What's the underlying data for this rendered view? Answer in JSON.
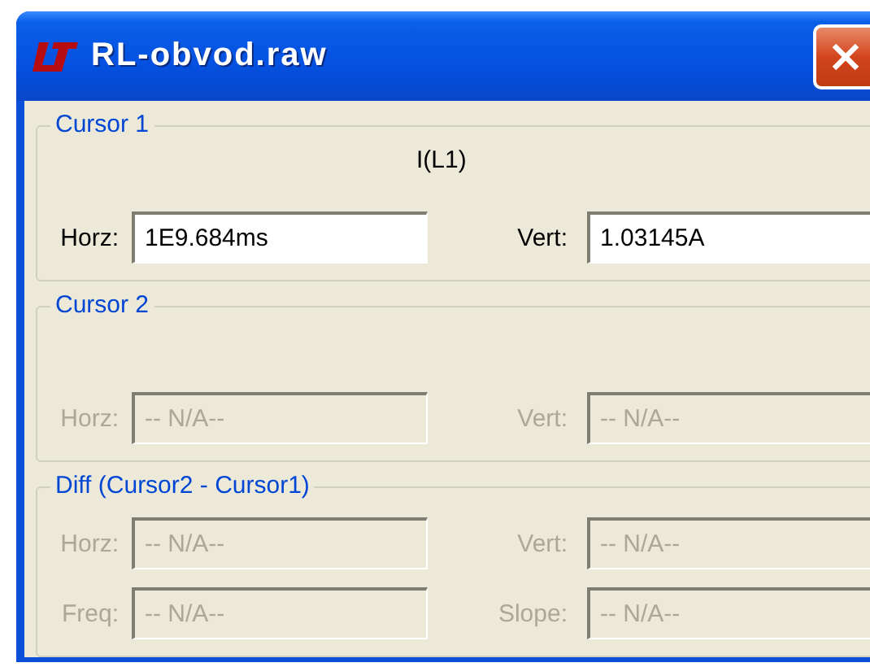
{
  "window": {
    "title": "RL-obvod.raw"
  },
  "groups": [
    {
      "kind": "cursor",
      "title": "Cursor 1",
      "trace": "I(L1)",
      "rows": [
        [
          {
            "label": "Horz:",
            "value": "1E9.684ms",
            "disabled": false
          },
          {
            "label": "Vert:",
            "value": "1.03145A",
            "disabled": false
          }
        ]
      ]
    },
    {
      "kind": "cursor",
      "title": "Cursor 2",
      "rows": [
        [
          {
            "label": "Horz:",
            "value": "-- N/A--",
            "disabled": true
          },
          {
            "label": "Vert:",
            "value": "-- N/A--",
            "disabled": true
          }
        ]
      ]
    },
    {
      "kind": "diff",
      "title": "Diff (Cursor2 - Cursor1)",
      "rows": [
        [
          {
            "label": "Horz:",
            "value": "-- N/A--",
            "disabled": true
          },
          {
            "label": "Vert:",
            "value": "-- N/A--",
            "disabled": true
          }
        ],
        [
          {
            "label": "Freq:",
            "value": "-- N/A--",
            "disabled": true
          },
          {
            "label": "Slope:",
            "value": "-- N/A--",
            "disabled": true
          }
        ]
      ]
    }
  ]
}
